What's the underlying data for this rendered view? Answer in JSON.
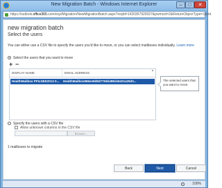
{
  "window": {
    "title": "New Migration Batch - Windows Internet Explorer",
    "min_label": "–",
    "max_label": "□",
    "close_label": "✕"
  },
  "address": {
    "prefix": "https://outlook.",
    "domain": "office365",
    "suffix": ".com/ecp/Migration/NewMigrationBatch.aspx?reqId=1420357920027&pwmcid=2&ReturnObjectType=1&mt"
  },
  "dialog": {
    "title": "new migration batch",
    "subtitle": "Select the users",
    "intro": "You can either use a CSV file to specify the users you'd like to move, or you can select mailboxes individually.",
    "learn_more": "Learn more"
  },
  "option_select": {
    "label": "Select the users that you want to move",
    "checked": true
  },
  "toolbar": {
    "add": "+",
    "remove": "−"
  },
  "table": {
    "columns": [
      "DISPLAY NAME",
      "EMAIL ADDRESS"
    ],
    "rows": [
      {
        "display_name": "HealthMailbox PFILNEE2013 0...",
        "email": "HealthMailbox965ee9d9d7794b488cb6421a25d3...",
        "selected": true
      }
    ],
    "scroll_up": "▲"
  },
  "tooltip": "The selected users that you want to move.",
  "option_csv": {
    "label": "Specify the users with a CSV file",
    "checked": false
  },
  "allow_unknown": {
    "label": "Allow unknown columns in the CSV file",
    "checked": false
  },
  "browse_label": "Browse...",
  "count_text": "1 mailboxes to migrate",
  "buttons": {
    "back": "Back",
    "next": "Next",
    "cancel": "Cancel"
  },
  "status": {
    "zoom": "100%"
  },
  "colors": {
    "accent": "#1e5aa8",
    "link": "#1a5fb4"
  }
}
